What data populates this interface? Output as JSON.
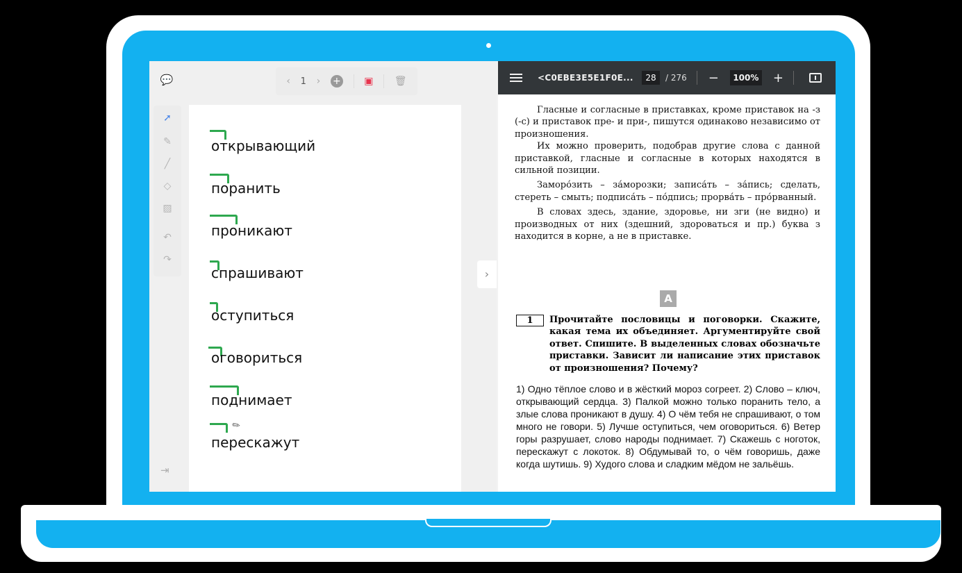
{
  "board": {
    "toolbar": {
      "prev": "‹",
      "page": "1",
      "next": "›",
      "add": "+"
    },
    "words": [
      "открывающий",
      "поранить",
      "проникают",
      "спрашивают",
      "оступиться",
      "оговориться",
      "поднимает",
      "перескажут"
    ],
    "collapse": "›"
  },
  "pdf": {
    "docname": "<C0EBE3E5E1F0E...",
    "page_current": "28",
    "page_total": "/ 276",
    "zoom": "100%",
    "zoom_minus": "−",
    "zoom_plus": "+",
    "paragraphs": [
      "Гласные и согласные в приставках, кроме приставок на -з (-с) и приставок пре- и при-, пишутся одинаково независимо от произношения.",
      "Их можно проверить, подобрав другие слова с данной приставкой, гласные и согласные в которых находятся в сильной позиции.",
      "Заморо́зить – за́морозки; записа́ть – за́пись; сделать, стереть – смыть; подписа́ть – по́дпись; прорва́ть – про́рванный.",
      "В словах здесь, здание, здоровье, ни зги (не видно) и производных от них (здешний, здороваться и пр.) буква з находится в корне, а не в приставке."
    ],
    "section": "A",
    "task_number": "1",
    "task_text": "Прочитайте пословицы и поговорки. Скажите, какая тема их объединяет. Аргументируйте свой ответ. Спишите. В выделенных словах обозначьте приставки. Зависит ли написание этих приставок от произношения? Почему?",
    "proverbs": "1) Одно тёплое слово и в жёсткий мороз согреет. 2) Слово – ключ, открывающий сердца. 3) Палкой можно только поранить тело, а злые слова проникают в душу. 4) О чём тебя не спрашивают, о том много не говори. 5) Лучше оступиться, чем оговориться. 6) Ветер горы разрушает, слово народы поднимает. 7) Скажешь с ноготок, перескажут с локоток. 8) Обдумывай то, о чём говоришь, даже когда шутишь. 9) Худого слова и сладким мёдом не зальёшь."
  },
  "colors": {
    "frame": "#13b1f0",
    "mark": "#2ea84f",
    "pdfbar": "#323639"
  }
}
